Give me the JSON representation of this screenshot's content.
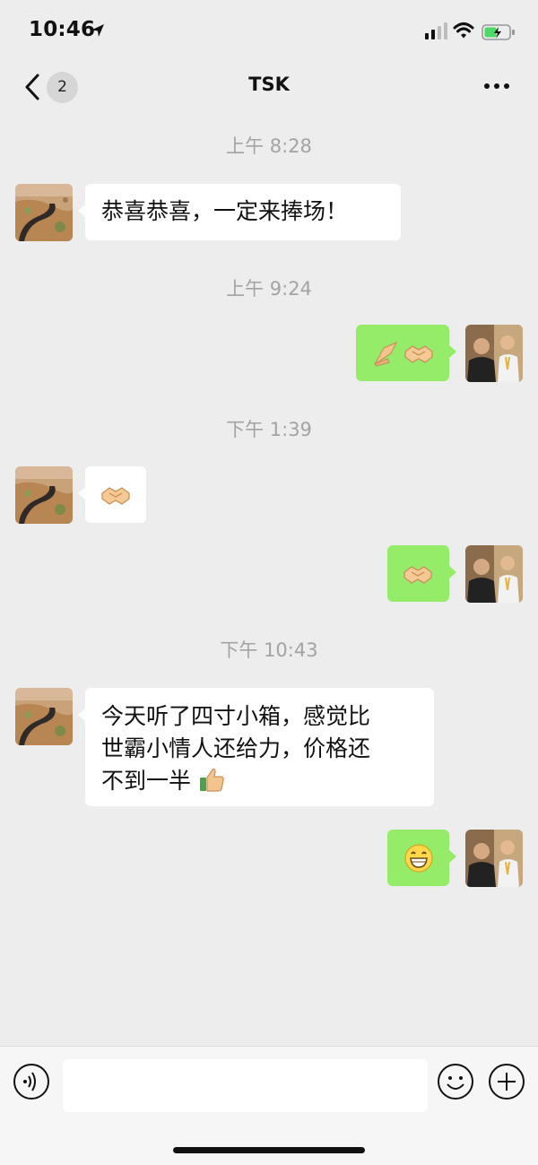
{
  "status_bar": {
    "time": "10:46"
  },
  "nav": {
    "unread_count": "2",
    "title": "TSK"
  },
  "timestamps": {
    "t1": "上午 8:28",
    "t2": "上午 9:24",
    "t3": "下午 1:39",
    "t4": "下午 10:43"
  },
  "messages": [
    {
      "sender": "incoming",
      "text": "恭喜恭喜，一定来捧场！"
    },
    {
      "sender": "outgoing",
      "icons": [
        "leaf-gesture-icon",
        "handshake-icon"
      ]
    },
    {
      "sender": "incoming",
      "icons": [
        "handshake-icon"
      ]
    },
    {
      "sender": "outgoing",
      "icons": [
        "handshake-icon"
      ]
    },
    {
      "sender": "incoming",
      "lines": [
        "今天听了四寸小箱，感觉比",
        "世霸小情人还给力，价格还",
        "不到一半"
      ],
      "icons": [
        "thumbs-up-icon"
      ]
    },
    {
      "sender": "outgoing",
      "icons": [
        "grinning-face-icon"
      ]
    }
  ],
  "colors": {
    "background": "#ededed",
    "outgoing_bubble": "#95ec69",
    "incoming_bubble": "#ffffff",
    "timestamp": "#a3a3a3"
  }
}
